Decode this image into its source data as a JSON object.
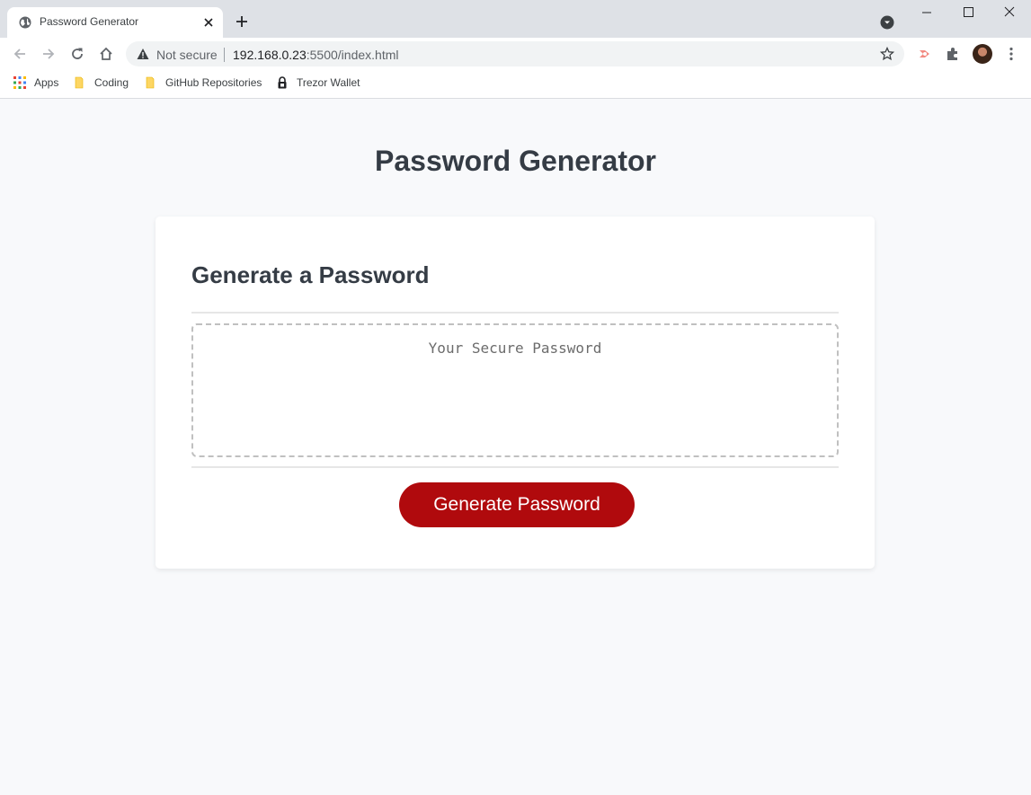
{
  "browser": {
    "tab_title": "Password Generator",
    "address": {
      "security_label": "Not secure",
      "url_host": "192.168.0.23",
      "url_rest": ":5500/index.html"
    },
    "bookmarks": [
      {
        "label": "Apps",
        "icon": "apps-grid-icon"
      },
      {
        "label": "Coding",
        "icon": "folder-icon"
      },
      {
        "label": "GitHub Repositories",
        "icon": "folder-icon"
      },
      {
        "label": "Trezor Wallet",
        "icon": "lock-icon"
      }
    ]
  },
  "page": {
    "title": "Password Generator",
    "card": {
      "title": "Generate a Password",
      "password_placeholder": "Your Secure Password",
      "password_value": "",
      "button_label": "Generate Password"
    }
  },
  "colors": {
    "button": "#b00a0d",
    "heading": "#353c45",
    "page_bg": "#f8f9fb"
  }
}
